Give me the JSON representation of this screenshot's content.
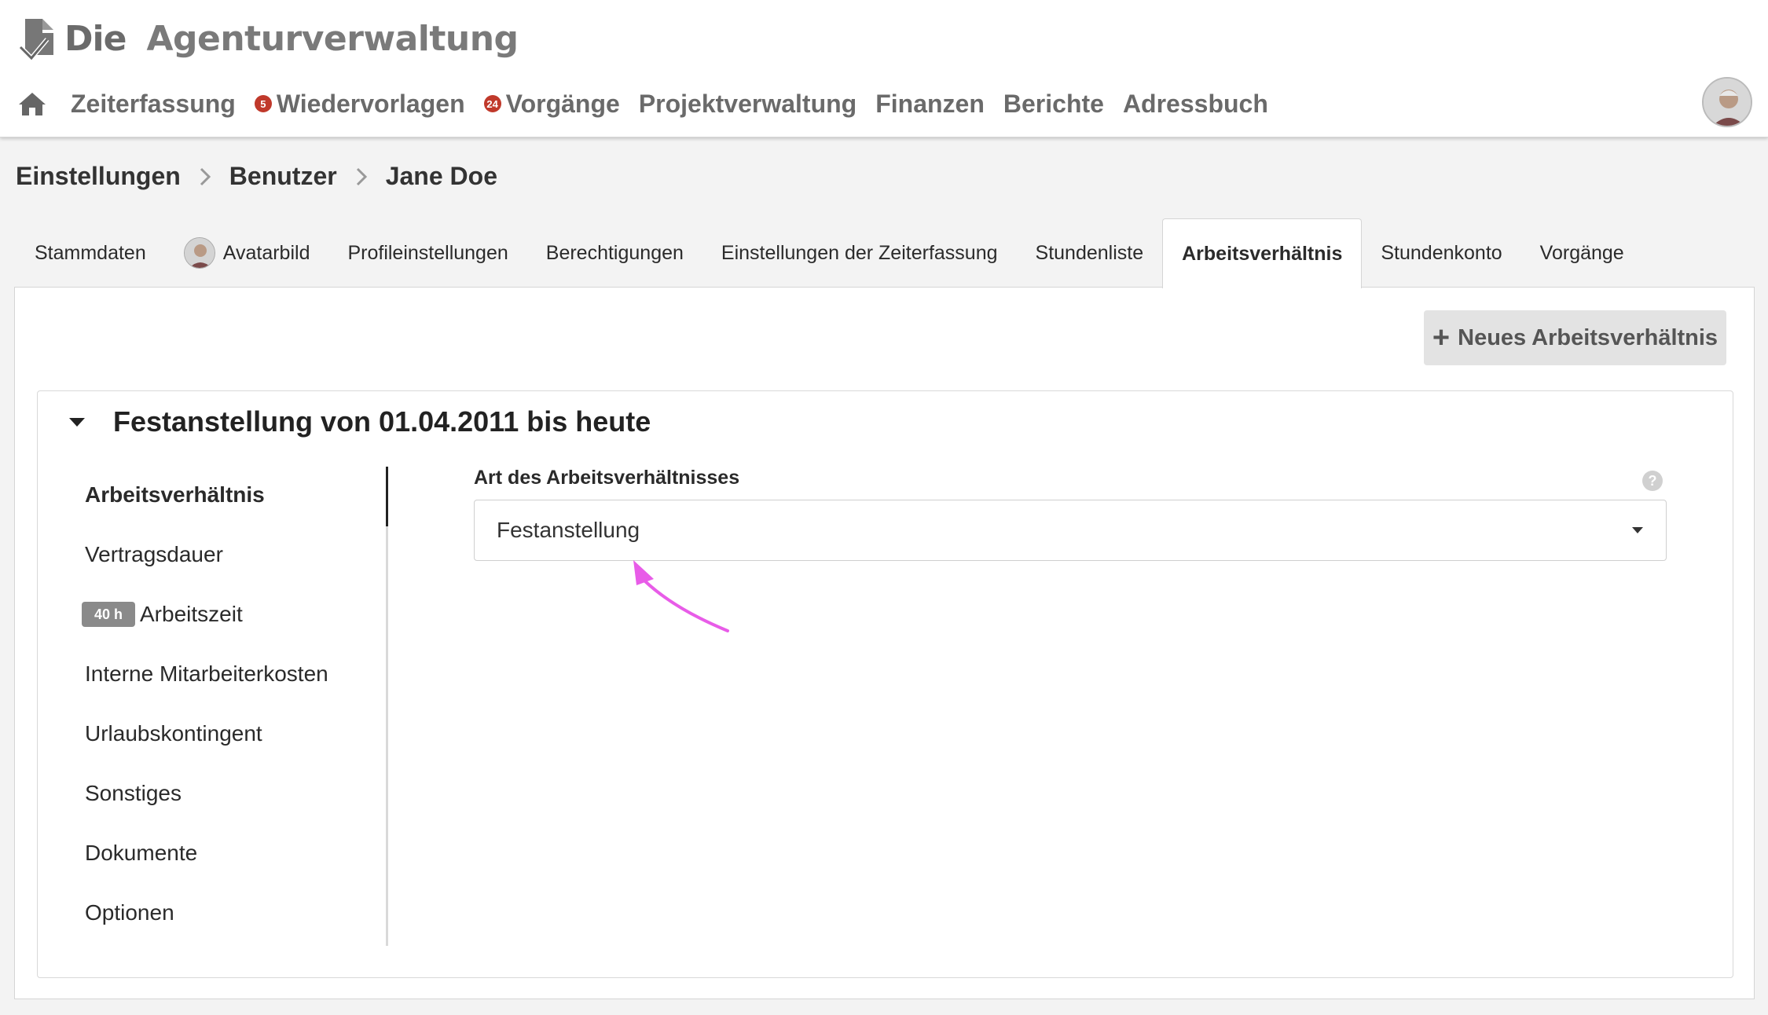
{
  "app": {
    "logo_die": "Die",
    "logo_name": "Agenturverwaltung"
  },
  "nav": {
    "items": [
      {
        "label": "Zeiterfassung",
        "badge": null
      },
      {
        "label": "Wiedervorlagen",
        "badge": "5"
      },
      {
        "label": "Vorgänge",
        "badge": "24"
      },
      {
        "label": "Projektverwaltung",
        "badge": null
      },
      {
        "label": "Finanzen",
        "badge": null
      },
      {
        "label": "Berichte",
        "badge": null
      },
      {
        "label": "Adressbuch",
        "badge": null
      }
    ],
    "badge_color": "#c0392b"
  },
  "breadcrumb": {
    "items": [
      "Einstellungen",
      "Benutzer",
      "Jane Doe"
    ]
  },
  "tabs": {
    "items": [
      "Stammdaten",
      "Avatarbild",
      "Profileinstellungen",
      "Berechtigungen",
      "Einstellungen der Zeiterfassung",
      "Stundenliste",
      "Arbeitsverhältnis",
      "Stundenkonto",
      "Vorgänge"
    ],
    "active": "Arbeitsverhältnis"
  },
  "toolbar": {
    "new_button_label": "Neues Arbeitsverhältnis"
  },
  "contract": {
    "title": "Festanstellung von 01.04.2011 bis heute",
    "sidenav": {
      "items": [
        "Arbeitsverhältnis",
        "Vertragsdauer",
        "Arbeitszeit",
        "Interne Mitarbeiterkosten",
        "Urlaubskontingent",
        "Sonstiges",
        "Dokumente",
        "Optionen"
      ],
      "active": "Arbeitsverhältnis",
      "hours_badge": "40 h"
    },
    "field": {
      "label": "Art des Arbeitsverhältnisses",
      "value": "Festanstellung"
    }
  },
  "colors": {
    "annotation_arrow": "#e85ce8"
  }
}
